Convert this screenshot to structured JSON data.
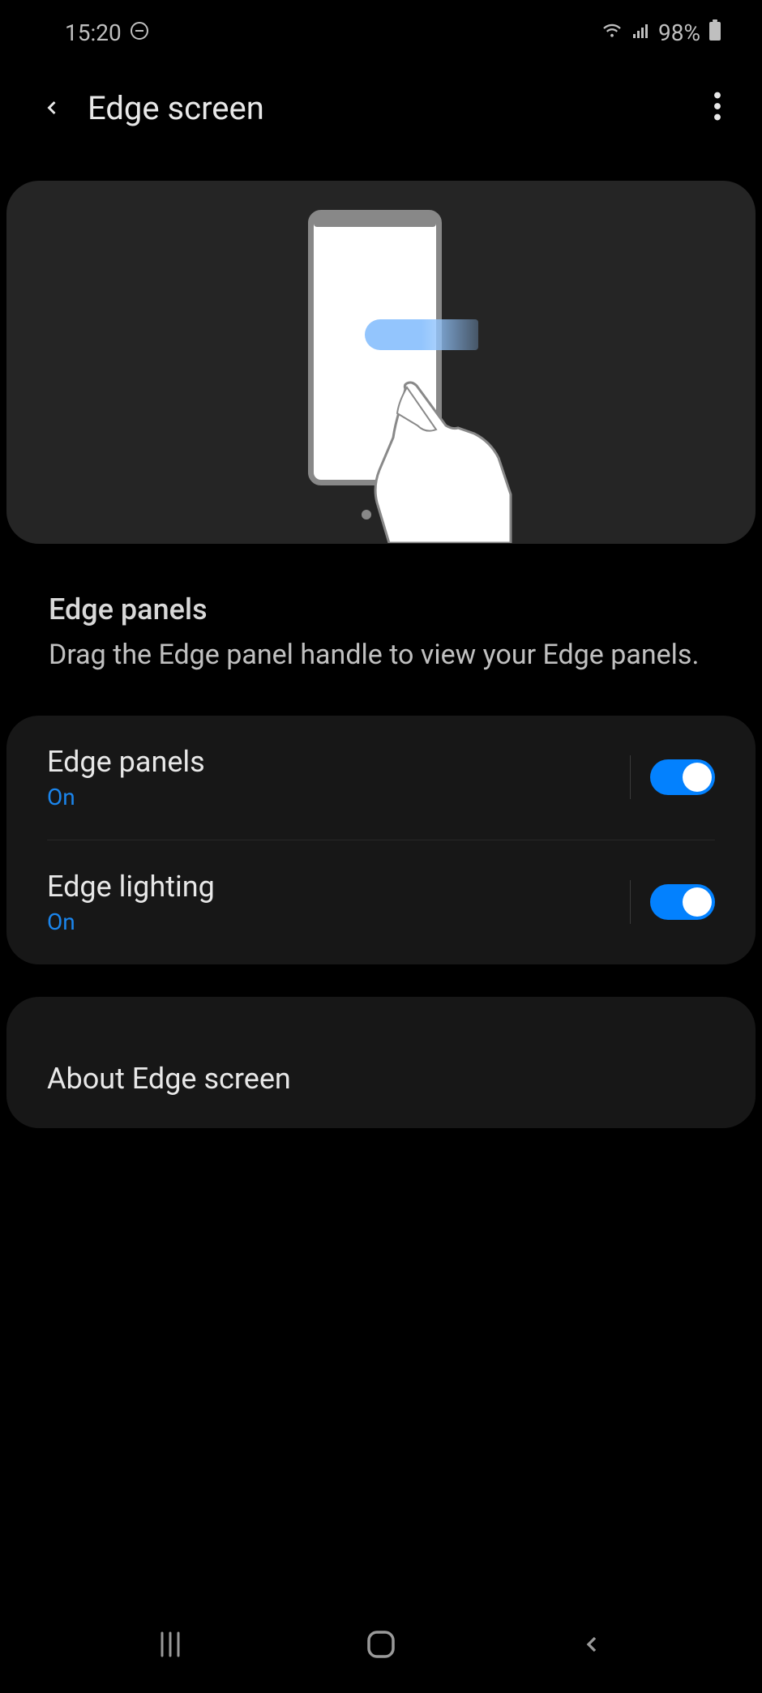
{
  "status_bar": {
    "time": "15:20",
    "battery_percent": "98%"
  },
  "header": {
    "title": "Edge screen"
  },
  "section": {
    "title": "Edge panels",
    "description": "Drag the Edge panel handle to view your Edge panels."
  },
  "settings": [
    {
      "label": "Edge panels",
      "status": "On",
      "toggle": true
    },
    {
      "label": "Edge lighting",
      "status": "On",
      "toggle": true
    }
  ],
  "about": {
    "label": "About Edge screen"
  },
  "colors": {
    "accent": "#0381fe",
    "accent_text": "#1b85ec",
    "card": "#171717",
    "illustration_card": "#252525"
  }
}
